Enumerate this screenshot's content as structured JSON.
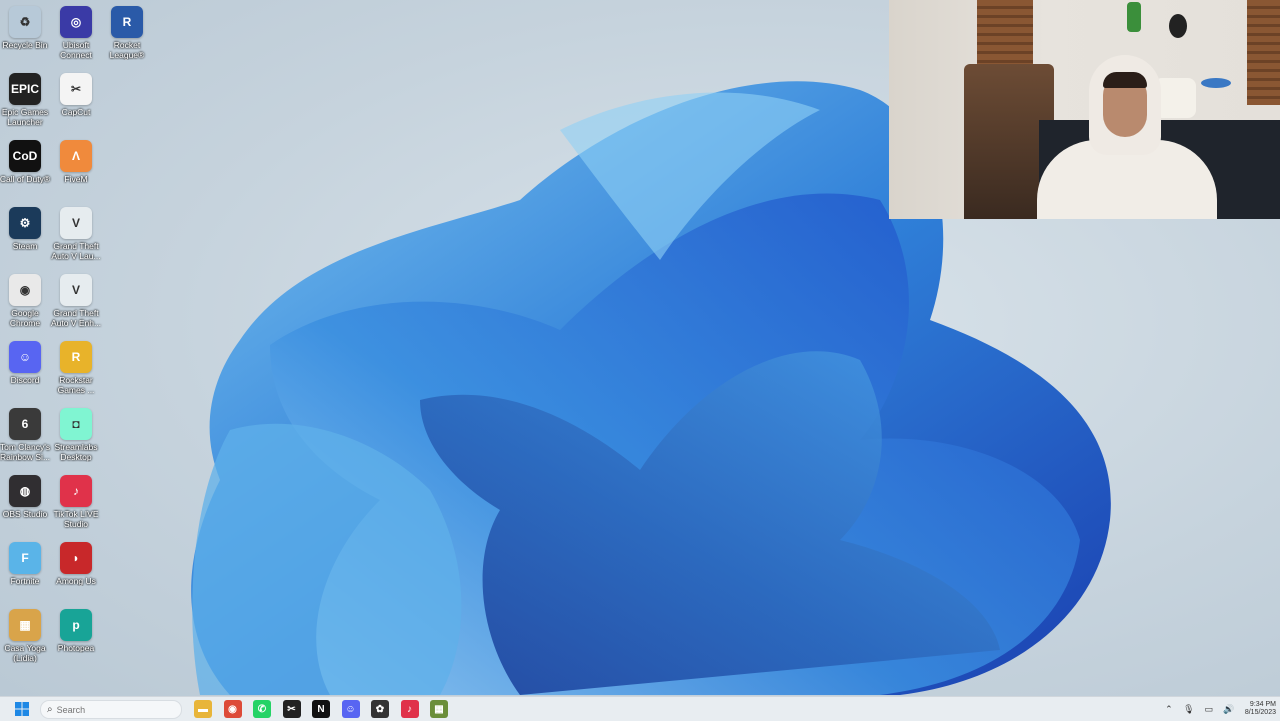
{
  "desktop": {
    "icons": [
      {
        "label": "Recycle Bin",
        "icon": "recycle-bin-icon",
        "color": "#b7c9d8",
        "glyph": "♻"
      },
      {
        "label": "Ubisoft Connect",
        "icon": "ubisoft-icon",
        "color": "#3a3aa6",
        "glyph": "◎"
      },
      {
        "label": "Rocket League®",
        "icon": "rocket-league-icon",
        "color": "#2a5aa8",
        "glyph": "R"
      },
      {
        "label": "Epic Games Launcher",
        "icon": "epic-games-icon",
        "color": "#222222",
        "glyph": "EPIC"
      },
      {
        "label": "CapCut",
        "icon": "capcut-icon",
        "color": "#f4f4f4",
        "glyph": "✂"
      },
      {
        "label": "Call of Duty®",
        "icon": "call-of-duty-icon",
        "color": "#111111",
        "glyph": "CoD"
      },
      {
        "label": "FiveM",
        "icon": "fivem-icon",
        "color": "#f08a3c",
        "glyph": "Λ"
      },
      {
        "label": "Steam",
        "icon": "steam-icon",
        "color": "#1b3a5a",
        "glyph": "⚙"
      },
      {
        "label": "Grand Theft Auto V Lau...",
        "icon": "gta-v-icon",
        "color": "#e6ecef",
        "glyph": "V"
      },
      {
        "label": "Google Chrome",
        "icon": "chrome-icon",
        "color": "#e9e9e9",
        "glyph": "◉"
      },
      {
        "label": "Grand Theft Auto V Enh...",
        "icon": "gta-v-enhanced-icon",
        "color": "#e6ecef",
        "glyph": "V"
      },
      {
        "label": "Discord",
        "icon": "discord-icon",
        "color": "#5865f2",
        "glyph": "☺"
      },
      {
        "label": "Rockstar Games ...",
        "icon": "rockstar-icon",
        "color": "#e8b32a",
        "glyph": "R"
      },
      {
        "label": "Tom Clancy's Rainbow Si...",
        "icon": "rainbow-six-icon",
        "color": "#3a3a3a",
        "glyph": "6"
      },
      {
        "label": "Streamlabs Desktop",
        "icon": "streamlabs-icon",
        "color": "#80f5d2",
        "glyph": "◘"
      },
      {
        "label": "OBS Studio",
        "icon": "obs-icon",
        "color": "#302e31",
        "glyph": "◍"
      },
      {
        "label": "TikTok LIVE Studio",
        "icon": "tiktok-live-icon",
        "color": "#e0324a",
        "glyph": "♪"
      },
      {
        "label": "Fortnite",
        "icon": "fortnite-icon",
        "color": "#5ab4e8",
        "glyph": "F"
      },
      {
        "label": "Among Us",
        "icon": "among-us-icon",
        "color": "#c8282a",
        "glyph": "◗"
      },
      {
        "label": "Casa Yoga (Lidia)",
        "icon": "folder-image-icon",
        "color": "#d9a44a",
        "glyph": "▦"
      },
      {
        "label": "Photopea",
        "icon": "photopea-icon",
        "color": "#18a497",
        "glyph": "p"
      }
    ]
  },
  "taskbar": {
    "start_icon": "windows-start-icon",
    "search_placeholder": "Search",
    "apps": [
      {
        "name": "file-explorer",
        "icon": "folder-icon",
        "color": "#e8b53a",
        "glyph": "▬"
      },
      {
        "name": "chrome",
        "icon": "chrome-icon",
        "color": "#dd4b39",
        "glyph": "◉"
      },
      {
        "name": "whatsapp",
        "icon": "whatsapp-icon",
        "color": "#25d366",
        "glyph": "✆"
      },
      {
        "name": "capcut",
        "icon": "capcut-icon",
        "color": "#222222",
        "glyph": "✂"
      },
      {
        "name": "netflix",
        "icon": "netflix-icon",
        "color": "#111111",
        "glyph": "N"
      },
      {
        "name": "discord",
        "icon": "discord-icon",
        "color": "#5865f2",
        "glyph": "☺"
      },
      {
        "name": "davinci",
        "icon": "davinci-icon",
        "color": "#333333",
        "glyph": "✿"
      },
      {
        "name": "tiktok",
        "icon": "tiktok-icon",
        "color": "#e0324a",
        "glyph": "♪"
      },
      {
        "name": "minecraft",
        "icon": "minecraft-icon",
        "color": "#6b8e3a",
        "glyph": "▦"
      }
    ],
    "tray": {
      "time": "9:34 PM",
      "date": "8/15/2023"
    }
  }
}
